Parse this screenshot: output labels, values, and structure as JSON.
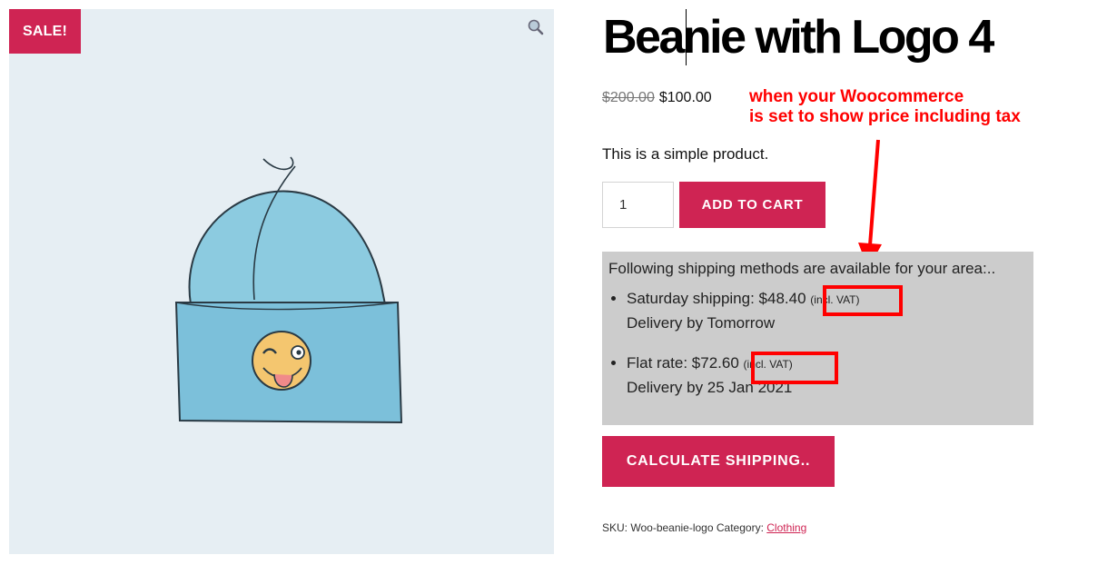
{
  "badge": {
    "sale": "SALE!"
  },
  "product": {
    "title": "Beanie with Logo 4",
    "price_old": "$200.00",
    "price_new": "$100.00",
    "short_description": "This is a simple product.",
    "quantity": "1"
  },
  "buttons": {
    "add_to_cart": "ADD TO CART",
    "calculate_shipping": "CALCULATE SHIPPING.."
  },
  "shipping": {
    "heading": "Following shipping methods are available for your area:..",
    "methods": [
      {
        "label": "Saturday shipping: $48.40",
        "vat": "(incl. VAT)",
        "delivery": "Delivery by Tomorrow"
      },
      {
        "label": "Flat rate: $72.60",
        "vat": "(incl. VAT)",
        "delivery": "Delivery by 25 Jan 2021"
      }
    ]
  },
  "annotation": {
    "line1": "when your Woocommerce",
    "line2": "is set to show price including tax"
  },
  "meta": {
    "sku_label": "SKU:",
    "sku": "Woo-beanie-logo",
    "category_label": "Category:",
    "category": "Clothing"
  },
  "colors": {
    "accent": "#cf2453",
    "annotation": "#ff0000",
    "shipping_box": "#cccccc",
    "gallery_bg": "#e6eef3"
  },
  "icons": {
    "zoom": "magnifier-icon",
    "arrow": "arrow-down-icon"
  }
}
